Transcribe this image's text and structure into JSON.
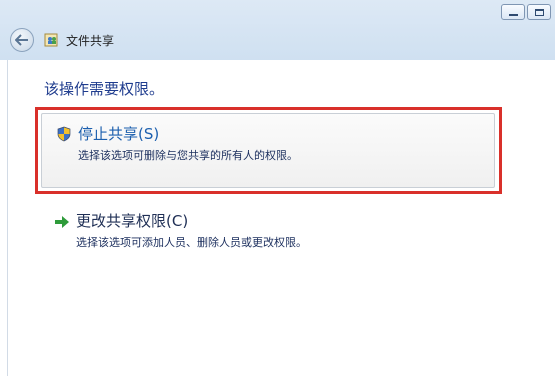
{
  "window": {
    "title": "文件共享"
  },
  "main": {
    "heading": "该操作需要权限。",
    "options": [
      {
        "title": "停止共享(S)",
        "description": "选择该选项可删除与您共享的所有人的权限。",
        "icon": "uac-shield-icon"
      },
      {
        "title": "更改共享权限(C)",
        "description": "选择该选项可添加人员、删除人员或更改权限。",
        "icon": "green-arrow-icon"
      }
    ]
  },
  "colors": {
    "highlight": "#d9302a",
    "link_blue": "#1c5fae",
    "heading_blue": "#1f3c8e"
  }
}
